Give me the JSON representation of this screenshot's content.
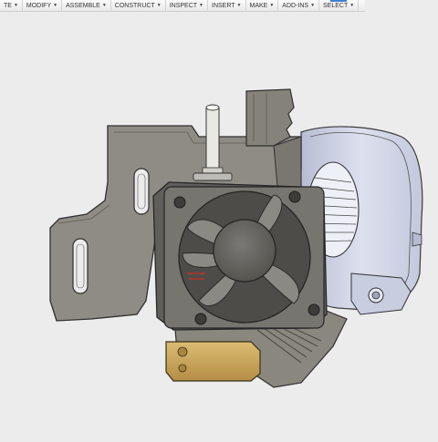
{
  "toolbar": {
    "items": [
      {
        "label": "TE"
      },
      {
        "label": "MODIFY"
      },
      {
        "label": "ASSEMBLE"
      },
      {
        "label": "CONSTRUCT"
      },
      {
        "label": "INSPECT"
      },
      {
        "label": "INSERT"
      },
      {
        "label": "MAKE"
      },
      {
        "label": "ADD-INS"
      },
      {
        "label": "SELECT"
      }
    ],
    "dropdown_glyph": "▼",
    "active_item": "SELECT"
  },
  "viewport": {
    "background": "#ececec",
    "model": "hotend-fan-shroud-assembly",
    "colors": {
      "bracket": "#8c8982",
      "fan_frame": "#6f6e6a",
      "blower": "#cfd3e6",
      "heater_block": "#c9a45a",
      "ptfe_tube": "#e8e8e2"
    }
  }
}
